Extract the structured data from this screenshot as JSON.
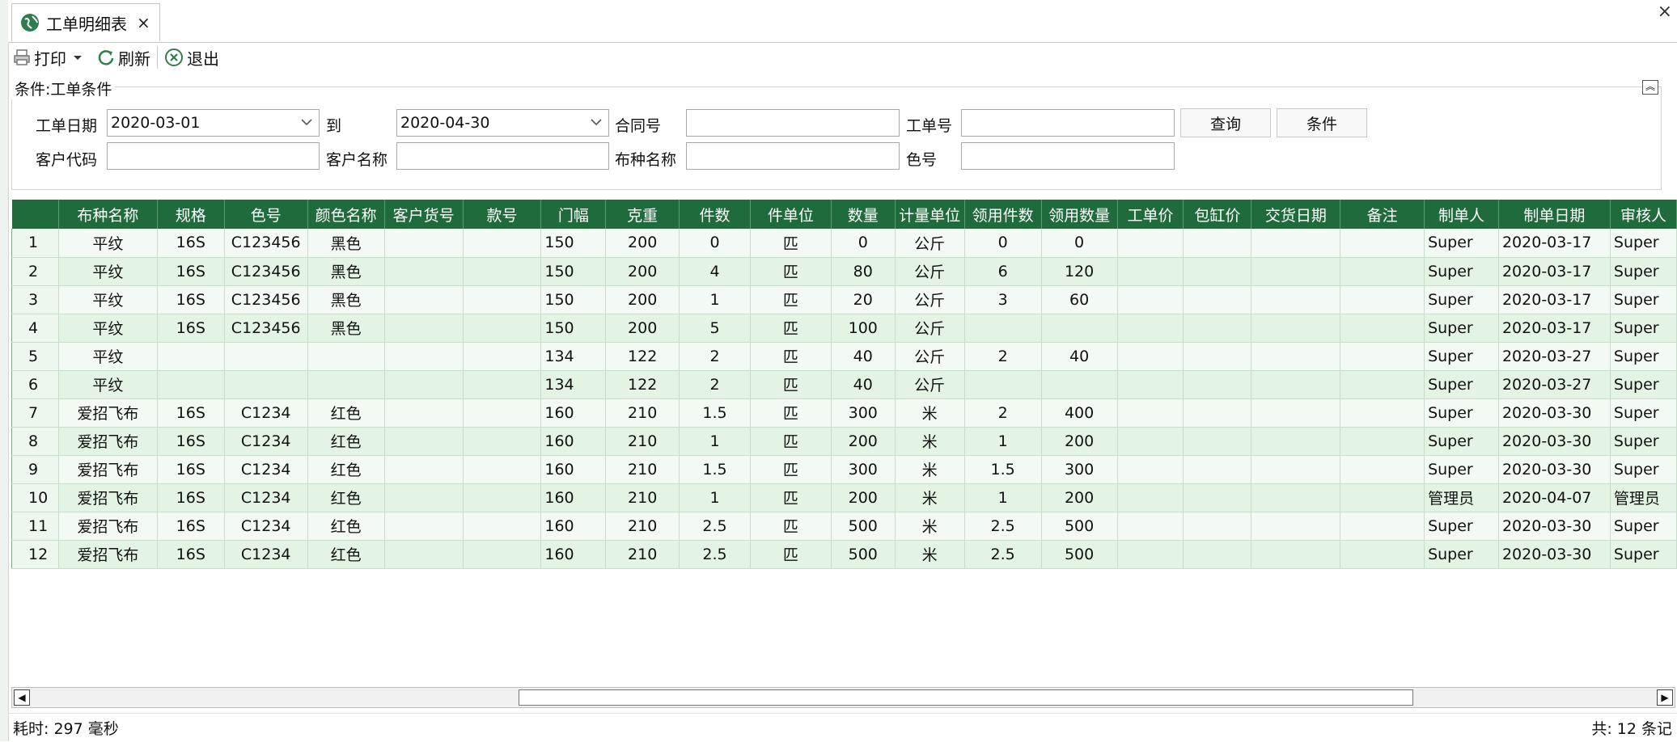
{
  "tab": {
    "label": "工单明细表",
    "close": "×"
  },
  "window": {
    "close": "×"
  },
  "toolbar": {
    "print": "打印",
    "refresh": "刷新",
    "exit": "退出"
  },
  "conditions": {
    "title": "条件:工单条件",
    "date_label": "工单日期",
    "date_from": "2020-03-01",
    "to_label": "到",
    "date_to": "2020-04-30",
    "contract_label": "合同号",
    "contract_value": "",
    "order_label": "工单号",
    "order_value": "",
    "query_button": "查询",
    "condition_button": "条件",
    "customer_code_label": "客户代码",
    "customer_code_value": "",
    "customer_name_label": "客户名称",
    "customer_name_value": "",
    "fabric_label": "布种名称",
    "fabric_value": "",
    "color_no_label": "色号",
    "color_no_value": ""
  },
  "grid": {
    "columns": [
      "布种名称",
      "规格",
      "色号",
      "颜色名称",
      "客户货号",
      "款号",
      "门幅",
      "克重",
      "件数",
      "件单位",
      "数量",
      "计量单位",
      "领用件数",
      "领用数量",
      "工单价",
      "包缸价",
      "交货日期",
      "备注",
      "制单人",
      "制单日期",
      "审核人"
    ],
    "rows": [
      [
        "1",
        "平纹",
        "16S",
        "C123456",
        "黑色",
        "",
        "",
        "150",
        "200",
        "0",
        "匹",
        "0",
        "公斤",
        "0",
        "0",
        "",
        "",
        "",
        "",
        "Super",
        "2020-03-17",
        "Super"
      ],
      [
        "2",
        "平纹",
        "16S",
        "C123456",
        "黑色",
        "",
        "",
        "150",
        "200",
        "4",
        "匹",
        "80",
        "公斤",
        "6",
        "120",
        "",
        "",
        "",
        "",
        "Super",
        "2020-03-17",
        "Super"
      ],
      [
        "3",
        "平纹",
        "16S",
        "C123456",
        "黑色",
        "",
        "",
        "150",
        "200",
        "1",
        "匹",
        "20",
        "公斤",
        "3",
        "60",
        "",
        "",
        "",
        "",
        "Super",
        "2020-03-17",
        "Super"
      ],
      [
        "4",
        "平纹",
        "16S",
        "C123456",
        "黑色",
        "",
        "",
        "150",
        "200",
        "5",
        "匹",
        "100",
        "公斤",
        "",
        "",
        "",
        "",
        "",
        "",
        "Super",
        "2020-03-17",
        "Super"
      ],
      [
        "5",
        "平纹",
        "",
        "",
        "",
        "",
        "",
        "134",
        "122",
        "2",
        "匹",
        "40",
        "公斤",
        "2",
        "40",
        "",
        "",
        "",
        "",
        "Super",
        "2020-03-27",
        "Super"
      ],
      [
        "6",
        "平纹",
        "",
        "",
        "",
        "",
        "",
        "134",
        "122",
        "2",
        "匹",
        "40",
        "公斤",
        "",
        "",
        "",
        "",
        "",
        "",
        "Super",
        "2020-03-27",
        "Super"
      ],
      [
        "7",
        "爱招飞布",
        "16S",
        "C1234",
        "红色",
        "",
        "",
        "160",
        "210",
        "1.5",
        "匹",
        "300",
        "米",
        "2",
        "400",
        "",
        "",
        "",
        "",
        "Super",
        "2020-03-30",
        "Super"
      ],
      [
        "8",
        "爱招飞布",
        "16S",
        "C1234",
        "红色",
        "",
        "",
        "160",
        "210",
        "1",
        "匹",
        "200",
        "米",
        "1",
        "200",
        "",
        "",
        "",
        "",
        "Super",
        "2020-03-30",
        "Super"
      ],
      [
        "9",
        "爱招飞布",
        "16S",
        "C1234",
        "红色",
        "",
        "",
        "160",
        "210",
        "1.5",
        "匹",
        "300",
        "米",
        "1.5",
        "300",
        "",
        "",
        "",
        "",
        "Super",
        "2020-03-30",
        "Super"
      ],
      [
        "10",
        "爱招飞布",
        "16S",
        "C1234",
        "红色",
        "",
        "",
        "160",
        "210",
        "1",
        "匹",
        "200",
        "米",
        "1",
        "200",
        "",
        "",
        "",
        "",
        "管理员",
        "2020-04-07",
        "管理员"
      ],
      [
        "11",
        "爱招飞布",
        "16S",
        "C1234",
        "红色",
        "",
        "",
        "160",
        "210",
        "2.5",
        "匹",
        "500",
        "米",
        "2.5",
        "500",
        "",
        "",
        "",
        "",
        "Super",
        "2020-03-30",
        "Super"
      ],
      [
        "12",
        "爱招飞布",
        "16S",
        "C1234",
        "红色",
        "",
        "",
        "160",
        "210",
        "2.5",
        "匹",
        "500",
        "米",
        "2.5",
        "500",
        "",
        "",
        "",
        "",
        "Super",
        "2020-03-30",
        "Super"
      ]
    ]
  },
  "status": {
    "elapsed": "耗时: 297 毫秒",
    "total": "共: 12 条记"
  },
  "colors": {
    "header_bg": "#1f6b3c",
    "row_odd": "#f3faf3",
    "row_even": "#e4f4e4"
  }
}
